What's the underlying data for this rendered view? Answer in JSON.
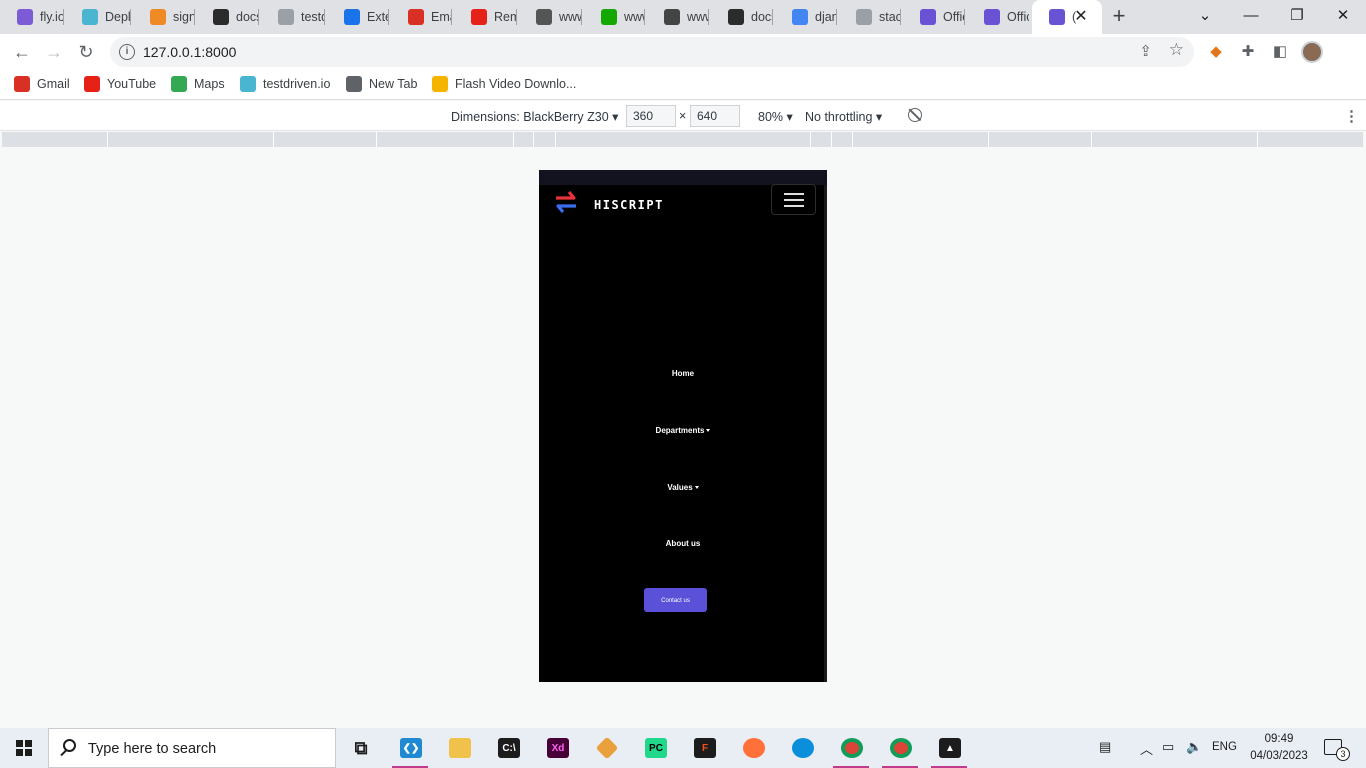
{
  "tabs": [
    {
      "label": "fly.io",
      "icon": "vpn-icon",
      "color": "#7c5cd6"
    },
    {
      "label": "Depl",
      "icon": "cube-icon",
      "color": "#4ab5d1"
    },
    {
      "label": "signi",
      "icon": "box-icon",
      "color": "#f08a24"
    },
    {
      "label": "docs",
      "icon": "django-icon",
      "color": "#2b2b2b"
    },
    {
      "label": "testd",
      "icon": "cube-icon",
      "color": "#9aa0a6"
    },
    {
      "label": "Exte",
      "icon": "puzzle-icon",
      "color": "#1a73e8"
    },
    {
      "label": "Emai",
      "icon": "gmail-icon",
      "color": "#d93025"
    },
    {
      "label": "Rem",
      "icon": "youtube-icon",
      "color": "#e62117"
    },
    {
      "label": "www",
      "icon": "notion-icon",
      "color": "#555"
    },
    {
      "label": "www",
      "icon": "upwork-icon",
      "color": "#14a800"
    },
    {
      "label": "www",
      "icon": "et-icon",
      "color": "#444"
    },
    {
      "label": "docs",
      "icon": "django-icon",
      "color": "#2b2b2b"
    },
    {
      "label": "djan",
      "icon": "google-icon",
      "color": "#4285f4"
    },
    {
      "label": "stack",
      "icon": "stackoverflow-icon",
      "color": "#9aa0a6"
    },
    {
      "label": "Offic",
      "icon": "bolt-icon",
      "color": "#6a52d4"
    },
    {
      "label": "Offic",
      "icon": "bolt-icon",
      "color": "#6a52d4"
    },
    {
      "label": "(",
      "icon": "bolt-icon",
      "color": "#6a52d4"
    }
  ],
  "toolbar": {
    "url": "127.0.0.1:8000"
  },
  "bookmarks": [
    {
      "label": "Gmail",
      "icon": "gmail-icon",
      "color": "#d93025"
    },
    {
      "label": "YouTube",
      "icon": "youtube-icon",
      "color": "#e62117"
    },
    {
      "label": "Maps",
      "icon": "maps-icon",
      "color": "#34a853"
    },
    {
      "label": "testdriven.io",
      "icon": "cube-icon",
      "color": "#4ab5d1"
    },
    {
      "label": "New Tab",
      "icon": "globe-icon",
      "color": "#5f6368"
    },
    {
      "label": "Flash Video Downlo...",
      "icon": "flash-icon",
      "color": "#f4b400"
    }
  ],
  "devtools": {
    "dimensions": "Dimensions: BlackBerry Z30",
    "width": "360",
    "height": "640",
    "times": "×",
    "zoom": "80%",
    "throttle": "No throttling"
  },
  "site": {
    "brand": "HISCRIPT",
    "nav": {
      "home": "Home",
      "departments": "Departments",
      "values": "Values",
      "about": "About us"
    },
    "contact": "Contact us",
    "accent": "#5b51d8"
  },
  "taskbar": {
    "search_placeholder": "Type here to search",
    "language": "ENG",
    "time": "09:49",
    "date": "04/03/2023",
    "notifications": "3"
  }
}
